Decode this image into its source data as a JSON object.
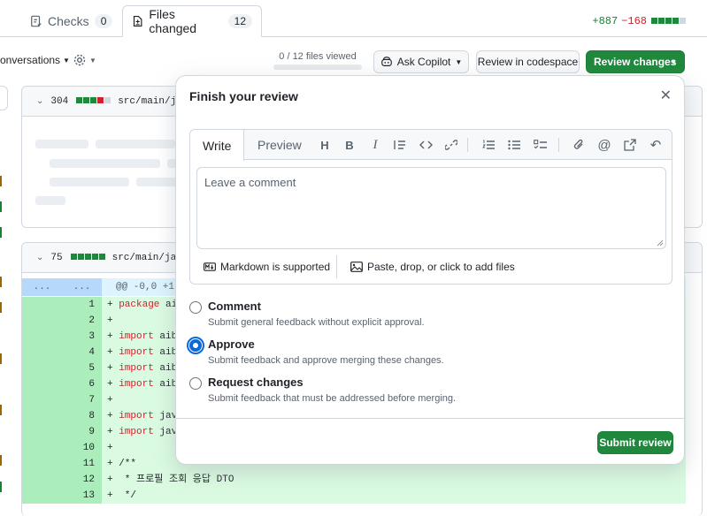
{
  "tabs": {
    "checks": {
      "label": "Checks",
      "count": "0"
    },
    "files_changed": {
      "label": "Files changed",
      "count": "12"
    }
  },
  "diffstat": {
    "additions": "+887",
    "deletions": "−168"
  },
  "toolbar": {
    "conversations": "onversations",
    "files_viewed": "0 / 12 files viewed",
    "ask_copilot": "Ask Copilot",
    "review_codespace": "Review in codespace",
    "review_changes": "Review changes"
  },
  "files": [
    {
      "count": "304",
      "path": "src/main/ja"
    },
    {
      "count": "75",
      "path": "src/main/jav"
    }
  ],
  "diff": {
    "hunk": {
      "left": "...",
      "right": "...",
      "text": "@@ -0,0 +1,"
    },
    "lines": [
      {
        "n": "1",
        "kw": "package",
        "rest": " aib"
      },
      {
        "n": "2",
        "kw": "",
        "rest": ""
      },
      {
        "n": "3",
        "kw": "import",
        "rest": " aibe"
      },
      {
        "n": "4",
        "kw": "import",
        "rest": " aibe"
      },
      {
        "n": "5",
        "kw": "import",
        "rest": " aibe"
      },
      {
        "n": "6",
        "kw": "import",
        "rest": " aibe"
      },
      {
        "n": "7",
        "kw": "",
        "rest": ""
      },
      {
        "n": "8",
        "kw": "import",
        "rest": " java"
      },
      {
        "n": "9",
        "kw": "import",
        "rest": " java"
      },
      {
        "n": "10",
        "kw": "",
        "rest": ""
      },
      {
        "n": "11",
        "kw": "",
        "rest": "/**"
      },
      {
        "n": "12",
        "kw": "",
        "rest": " * 프로필 조회 응답 DTO"
      },
      {
        "n": "13",
        "kw": "",
        "rest": " */"
      }
    ]
  },
  "modal": {
    "title": "Finish your review",
    "write_tab": "Write",
    "preview_tab": "Preview",
    "placeholder": "Leave a comment",
    "markdown": "Markdown is supported",
    "attach": "Paste, drop, or click to add files",
    "options": [
      {
        "label": "Comment",
        "desc": "Submit general feedback without explicit approval.",
        "checked": false
      },
      {
        "label": "Approve",
        "desc": "Submit feedback and approve merging these changes.",
        "checked": true
      },
      {
        "label": "Request changes",
        "desc": "Submit feedback that must be addressed before merging.",
        "checked": false
      }
    ],
    "submit": "Submit review"
  },
  "colors": {
    "accent_green": "#1f883d",
    "accent_blue": "#0969da",
    "deletion_red": "#cf222e"
  }
}
